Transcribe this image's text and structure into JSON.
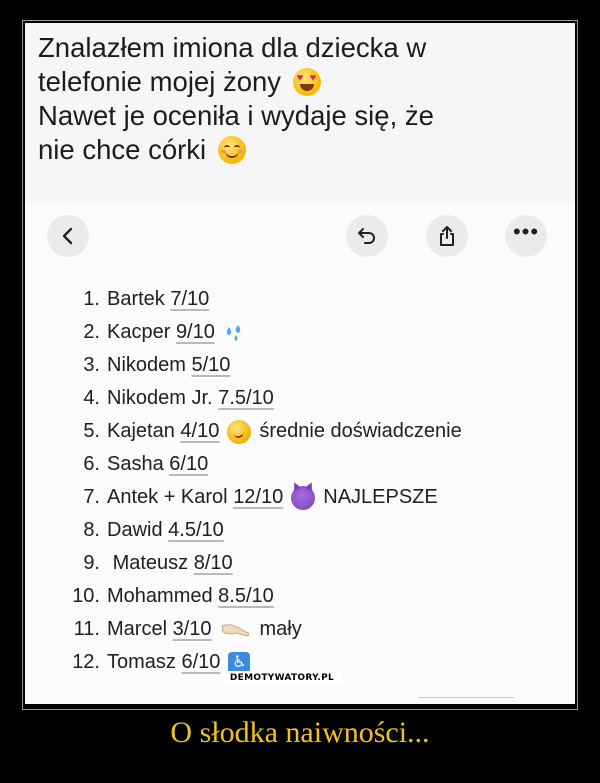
{
  "caption": {
    "line1": "Znalazłem imiona dla dziecka w",
    "line2": "telefonie mojej żony",
    "line3": "Nawet je oceniła i wydaje się, że",
    "line4": "nie chce córki"
  },
  "toolbar": {
    "back_icon": "chevron-left-icon",
    "undo_icon": "undo-icon",
    "share_icon": "share-icon",
    "more_icon": "more-dots-icon"
  },
  "list": [
    {
      "num": "1.",
      "name": "Bartek",
      "score": "7/10",
      "note": "",
      "icon": ""
    },
    {
      "num": "2.",
      "name": "Kacper",
      "score": "9/10",
      "note": "",
      "icon": "sweat-droplets-icon"
    },
    {
      "num": "3.",
      "name": "Nikodem",
      "score": "5/10",
      "note": "",
      "icon": ""
    },
    {
      "num": "4.",
      "name": "Nikodem Jr.",
      "score": "7.5/10",
      "note": "",
      "icon": ""
    },
    {
      "num": "5.",
      "name": "Kajetan",
      "score": "4/10",
      "note": "średnie doświadczenie",
      "icon": "smirk-face-icon"
    },
    {
      "num": "6.",
      "name": "Sasha",
      "score": "6/10",
      "note": "",
      "icon": ""
    },
    {
      "num": "7.",
      "name": "Antek + Karol",
      "score": "12/10",
      "note": "NAJLEPSZE",
      "icon": "devil-face-icon"
    },
    {
      "num": "8.",
      "name": "Dawid",
      "score": "4.5/10",
      "note": "",
      "icon": ""
    },
    {
      "num": "9.",
      "name": "Mateusz",
      "score": "8/10",
      "note": "",
      "icon": ""
    },
    {
      "num": "10.",
      "name": "Mohammed",
      "score": "8.5/10",
      "note": "",
      "icon": ""
    },
    {
      "num": "11.",
      "name": "Marcel",
      "score": "3/10",
      "note": "mały",
      "icon": "pinching-hand-icon"
    },
    {
      "num": "12.",
      "name": "Tomasz",
      "score": "6/10",
      "note": "",
      "icon": "wheelchair-symbol-icon"
    }
  ],
  "brand": "DEMOTYWATORY.PL",
  "title": "O słodka naiwności...",
  "colors": {
    "title": "#f0c419",
    "background": "#000000"
  }
}
